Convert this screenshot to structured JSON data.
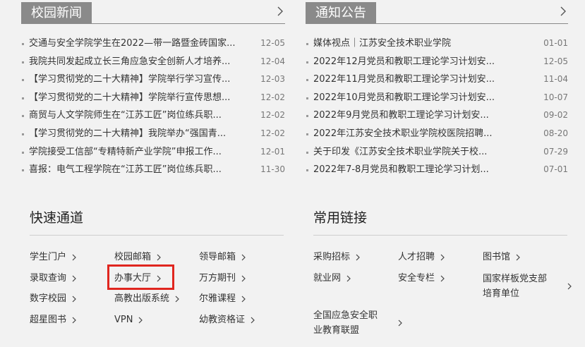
{
  "campus_news": {
    "title": "校园新闻",
    "items": [
      {
        "title": "交通与安全学院学生在2022—带一路暨金砖国家...",
        "date": "12-05"
      },
      {
        "title": "我院共同发起成立长三角应急安全创新人才培养...",
        "date": "12-04"
      },
      {
        "title": "【学习贯彻党的二十大精神】学院举行学习宣传...",
        "date": "12-03"
      },
      {
        "title": "【学习贯彻党的二十大精神】学院举行宣传思想...",
        "date": "12-02"
      },
      {
        "title": "商贸与人文学院师生在“江苏工匠”岗位练兵职...",
        "date": "12-02"
      },
      {
        "title": "【学习贯彻党的二十大精神】我院举办“强国青...",
        "date": "12-02"
      },
      {
        "title": "学院接受工信部“专精特新产业学院”申报工作...",
        "date": "12-01"
      },
      {
        "title": "喜报：电气工程学院在“江苏工匠”岗位练兵职...",
        "date": "11-30"
      }
    ]
  },
  "notices": {
    "title": "通知公告",
    "items": [
      {
        "title": "媒体视点｜江苏安全技术职业学院",
        "date": "01-01"
      },
      {
        "title": "2022年12月党员和教职工理论学习计划安...",
        "date": "12-05"
      },
      {
        "title": "2022年11月党员和教职工理论学习计划安...",
        "date": "11-04"
      },
      {
        "title": "2022年10月党员和教职工理论学习计划安...",
        "date": "10-07"
      },
      {
        "title": "2022年9月党员和教职工理论学习计划安...",
        "date": "09-02"
      },
      {
        "title": "2022年江苏安全技术职业学院校医院招聘...",
        "date": "08-20"
      },
      {
        "title": "关于印发《江苏安全技术职业学院关于校...",
        "date": "07-29"
      },
      {
        "title": "2022年7-8月党员和教职工理论学习计划...",
        "date": "07-01"
      }
    ]
  },
  "quick_access": {
    "title": "快速通道",
    "links": [
      [
        "学生门户",
        "校园邮箱",
        "领导邮箱"
      ],
      [
        "录取查询",
        "办事大厅",
        "万方期刊"
      ],
      [
        "数字校园",
        "高教出版系统",
        "尔雅课程"
      ],
      [
        "超星图书",
        "VPN",
        "幼教资格证"
      ]
    ]
  },
  "common_links": {
    "title": "常用链接",
    "links": {
      "purchase": "采购招标",
      "talent": "人才招聘",
      "library": "图书馆",
      "employment": "就业网",
      "safety": "安全专栏",
      "party_line1": "国家样板党支部",
      "party_line2": "培育单位",
      "alliance_line1": "全国应急安全职",
      "alliance_line2": "业教育联盟"
    }
  },
  "icons": {
    "more": "chevron-right-icon",
    "link": "chevron-right-icon"
  },
  "colors": {
    "tab_bg": "#8a8a8a",
    "highlight": "#e0261f",
    "page_bg": "#f2f2f2"
  }
}
